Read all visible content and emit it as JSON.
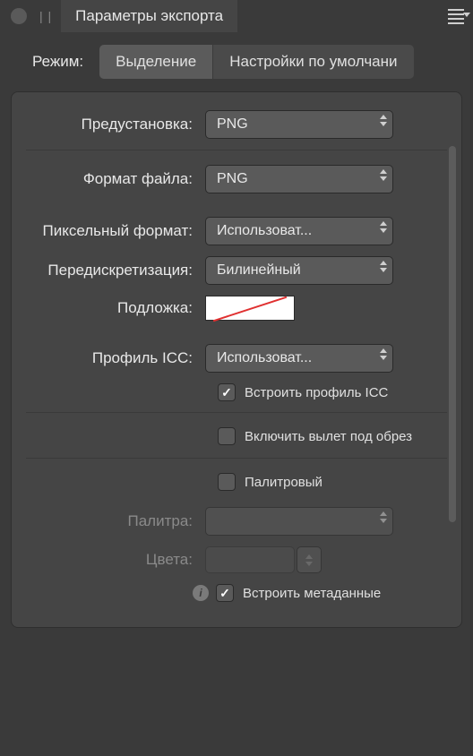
{
  "header": {
    "tab_title": "Параметры экспорта",
    "pipes": "| |"
  },
  "mode": {
    "label": "Режим:",
    "selection": "Выделение",
    "defaults": "Настройки по умолчани"
  },
  "fields": {
    "preset_label": "Предустановка:",
    "preset_value": "PNG",
    "file_format_label": "Формат файла:",
    "file_format_value": "PNG",
    "pixel_format_label": "Пиксельный формат:",
    "pixel_format_value": "Использоват...",
    "resample_label": "Передискретизация:",
    "resample_value": "Билинейный",
    "matte_label": "Подложка:",
    "icc_profile_label": "Профиль ICC:",
    "icc_profile_value": "Использоват...",
    "embed_icc_label": "Встроить профиль ICC",
    "include_bleed_label": "Включить вылет под обрез",
    "indexed_label": "Палитровый",
    "palette_label": "Палитра:",
    "colors_label": "Цвета:",
    "embed_metadata_label": "Встроить метаданные"
  },
  "checks": {
    "embed_icc": true,
    "include_bleed": false,
    "indexed": false,
    "embed_metadata": true
  }
}
